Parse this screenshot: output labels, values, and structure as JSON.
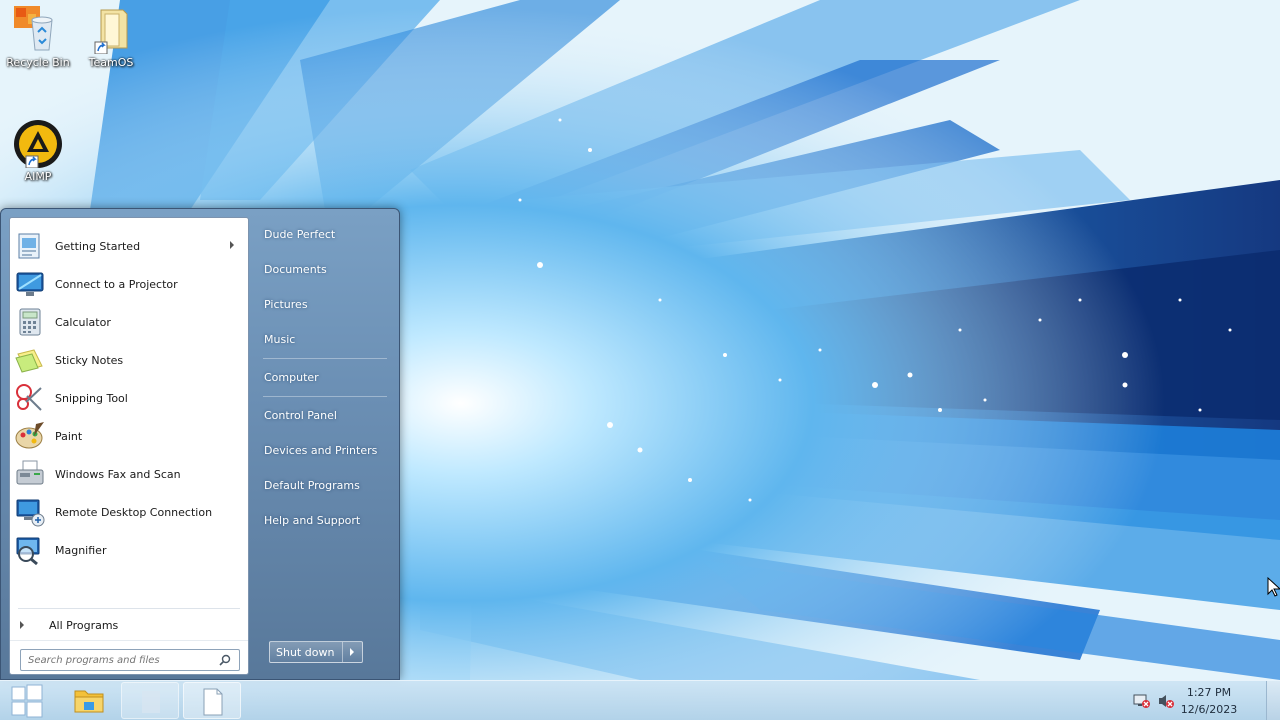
{
  "desktop": {
    "icons": [
      {
        "label": "Recycle Bin"
      },
      {
        "label": "TeamOS"
      },
      {
        "label": "AIMP"
      }
    ]
  },
  "start_menu": {
    "programs": [
      {
        "label": "Getting Started",
        "has_submenu": true
      },
      {
        "label": "Connect to a Projector"
      },
      {
        "label": "Calculator"
      },
      {
        "label": "Sticky Notes"
      },
      {
        "label": "Snipping Tool"
      },
      {
        "label": "Paint"
      },
      {
        "label": "Windows Fax and Scan"
      },
      {
        "label": "Remote Desktop Connection"
      },
      {
        "label": "Magnifier"
      }
    ],
    "all_programs": "All Programs",
    "search_placeholder": "Search programs and files",
    "right_items": [
      {
        "label": "Dude Perfect"
      },
      {
        "label": "Documents"
      },
      {
        "label": "Pictures"
      },
      {
        "label": "Music"
      },
      {
        "label": "Computer"
      },
      {
        "label": "Control Panel"
      },
      {
        "label": "Devices and Printers"
      },
      {
        "label": "Default Programs"
      },
      {
        "label": "Help and Support"
      }
    ],
    "shutdown_label": "Shut down"
  },
  "taskbar": {
    "pinned": [
      {
        "icon": "folder-icon"
      },
      {
        "icon": "blank-app-icon"
      },
      {
        "icon": "document-icon"
      }
    ],
    "tray": {
      "icons": [
        "network-disconnected-icon",
        "volume-muted-icon"
      ],
      "time": "1:27 PM",
      "date": "12/6/2023"
    }
  },
  "colors": {
    "accent": "#1f7ad6",
    "start_menu_right": "#6b8fb4",
    "taskbar": "#c4dcef"
  }
}
